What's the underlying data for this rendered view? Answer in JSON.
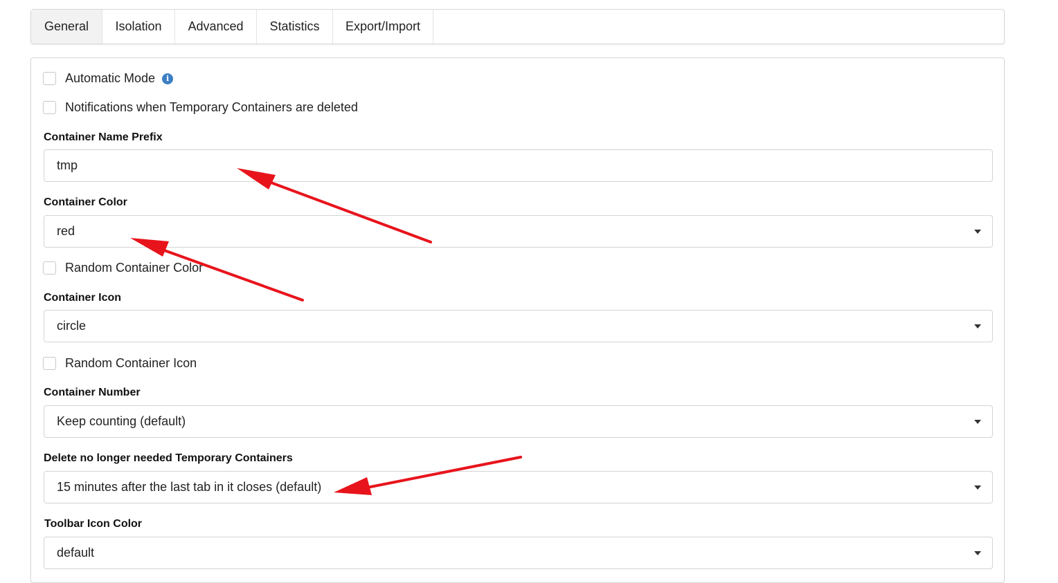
{
  "tabs": [
    {
      "label": "General",
      "active": true
    },
    {
      "label": "Isolation",
      "active": false
    },
    {
      "label": "Advanced",
      "active": false
    },
    {
      "label": "Statistics",
      "active": false
    },
    {
      "label": "Export/Import",
      "active": false
    }
  ],
  "general": {
    "automatic_mode": {
      "label": "Automatic Mode",
      "checked": false
    },
    "notifications": {
      "label": "Notifications when Temporary Containers are deleted",
      "checked": false
    },
    "name_prefix": {
      "label": "Container Name Prefix",
      "value": "tmp"
    },
    "color": {
      "label": "Container Color",
      "value": "red"
    },
    "random_color": {
      "label": "Random Container Color",
      "checked": false
    },
    "icon": {
      "label": "Container Icon",
      "value": "circle"
    },
    "random_icon": {
      "label": "Random Container Icon",
      "checked": false
    },
    "number": {
      "label": "Container Number",
      "value": "Keep counting (default)"
    },
    "delete": {
      "label": "Delete no longer needed Temporary Containers",
      "value": "15 minutes after the last tab in it closes (default)"
    },
    "toolbar_color": {
      "label": "Toolbar Icon Color",
      "value": "default"
    }
  },
  "icons": {
    "info": "info-icon",
    "select_caret": "chevron-down-icon"
  },
  "colors": {
    "annotation_arrow": "#e8141c",
    "info_icon": "#3c7fc4",
    "active_tab": "#f2f2f2"
  }
}
